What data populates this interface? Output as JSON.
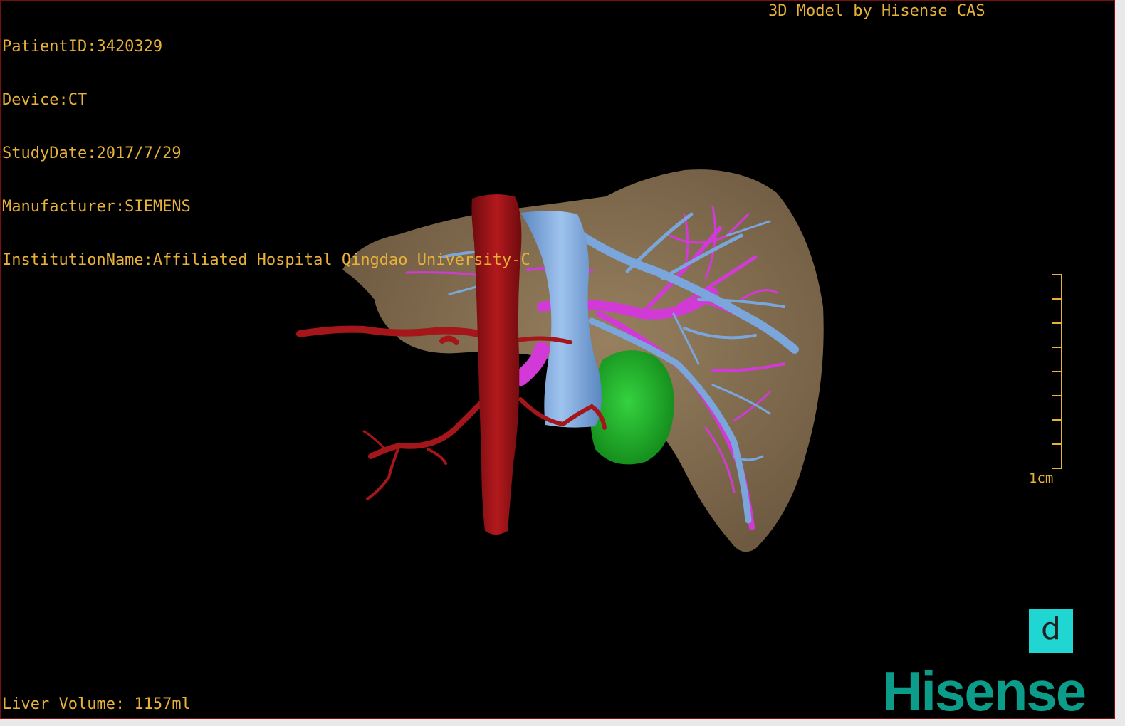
{
  "info": {
    "patient_id": "PatientID:3420329",
    "device": "Device:CT",
    "study_date": "StudyDate:2017/7/29",
    "manufacturer": "Manufacturer:SIEMENS",
    "institution": "InstitutionName:Affiliated Hospital Qingdao University-C"
  },
  "brand_text": "3D Model by Hisense CAS",
  "liver_volume": "Liver Volume: 1157ml",
  "scale_label": "1cm",
  "view_button_label": "d",
  "logo_text": "Hisense",
  "colors": {
    "overlay_text": "#e8b13a",
    "liver": "#8b7457",
    "artery": "#a5161b",
    "portal_vein": "#7aa6dc",
    "hepatic_vein": "#d23ad8",
    "gallbladder": "#20b52a",
    "view_button": "#1fd6d2",
    "logo": "#0c9c8a"
  }
}
